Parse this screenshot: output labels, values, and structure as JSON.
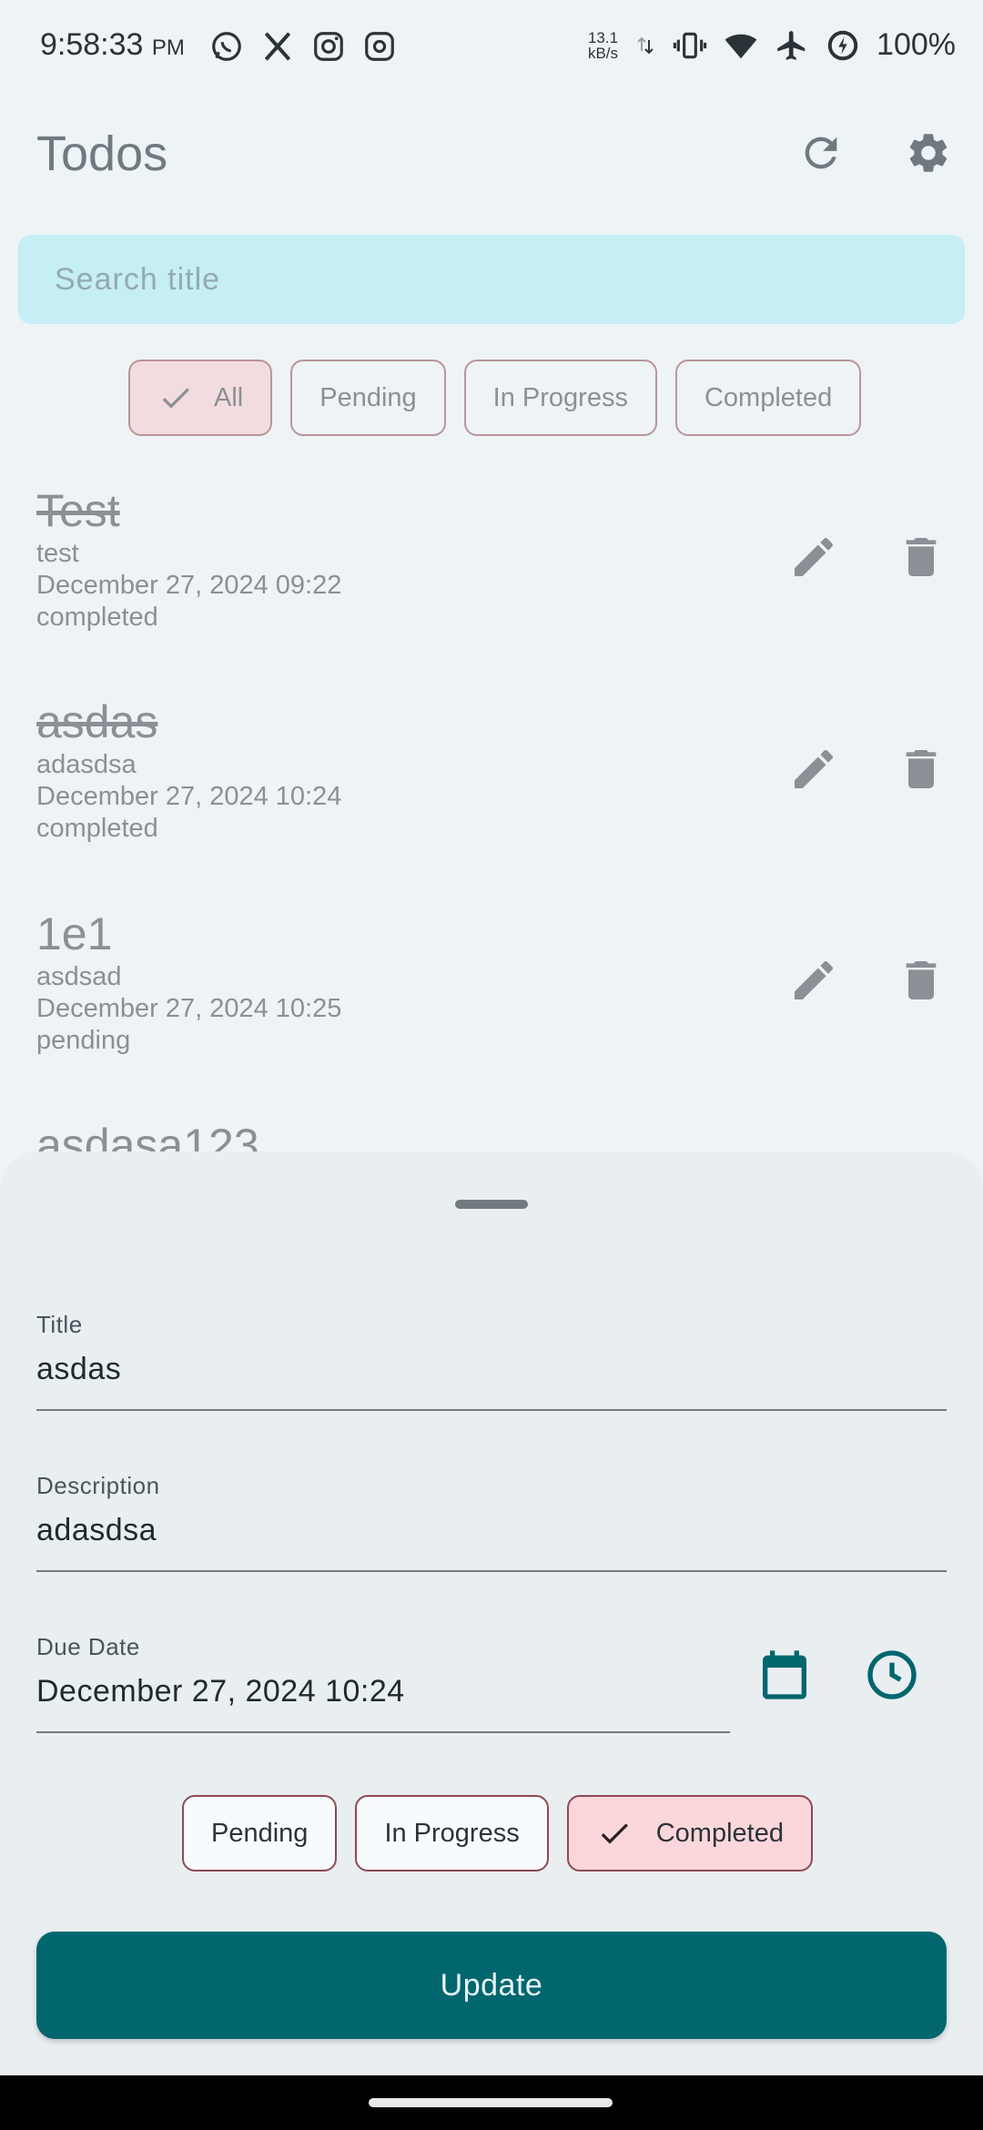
{
  "status_bar": {
    "time": "9:58:33",
    "ampm": "PM",
    "net_speed": "13.1",
    "net_unit": "kB/s",
    "battery": "100%",
    "left_icons": [
      "whatsapp-icon",
      "x-icon",
      "instagram-icon",
      "threads-icon"
    ],
    "right_icons": [
      "data-arrows-icon",
      "vibrate-icon",
      "wifi-icon",
      "airplane-icon",
      "battery-saver-icon"
    ]
  },
  "appbar": {
    "title": "Todos",
    "refresh_icon": "refresh-icon",
    "settings_icon": "gear-icon"
  },
  "search": {
    "placeholder": "Search title",
    "value": ""
  },
  "filters": {
    "chips": [
      "All",
      "Pending",
      "In Progress",
      "Completed"
    ],
    "selected": "All"
  },
  "todos": [
    {
      "title": "Test",
      "description": "test",
      "due": "December 27, 2024 09:22",
      "status": "completed"
    },
    {
      "title": "asdas",
      "description": "adasdsa",
      "due": "December 27, 2024 10:24",
      "status": "completed"
    },
    {
      "title": "1e1",
      "description": "asdsad",
      "due": "December 27, 2024 10:25",
      "status": "pending"
    },
    {
      "title": "asdasa123"
    }
  ],
  "sheet": {
    "title_label": "Title",
    "title_value": "asdas",
    "description_label": "Description",
    "description_value": "adasdsa",
    "due_label": "Due Date",
    "due_value": "December 27, 2024 10:24",
    "status_chips": [
      "Pending",
      "In Progress",
      "Completed"
    ],
    "status_selected": "Completed",
    "update_label": "Update"
  },
  "colors": {
    "background": "#eef3f6",
    "search_bg": "#c5eef5",
    "chip_selected": "#f3dce0",
    "accent": "#02666f",
    "status_selected": "#fbd7dc",
    "muted_text": "#8a9095"
  }
}
